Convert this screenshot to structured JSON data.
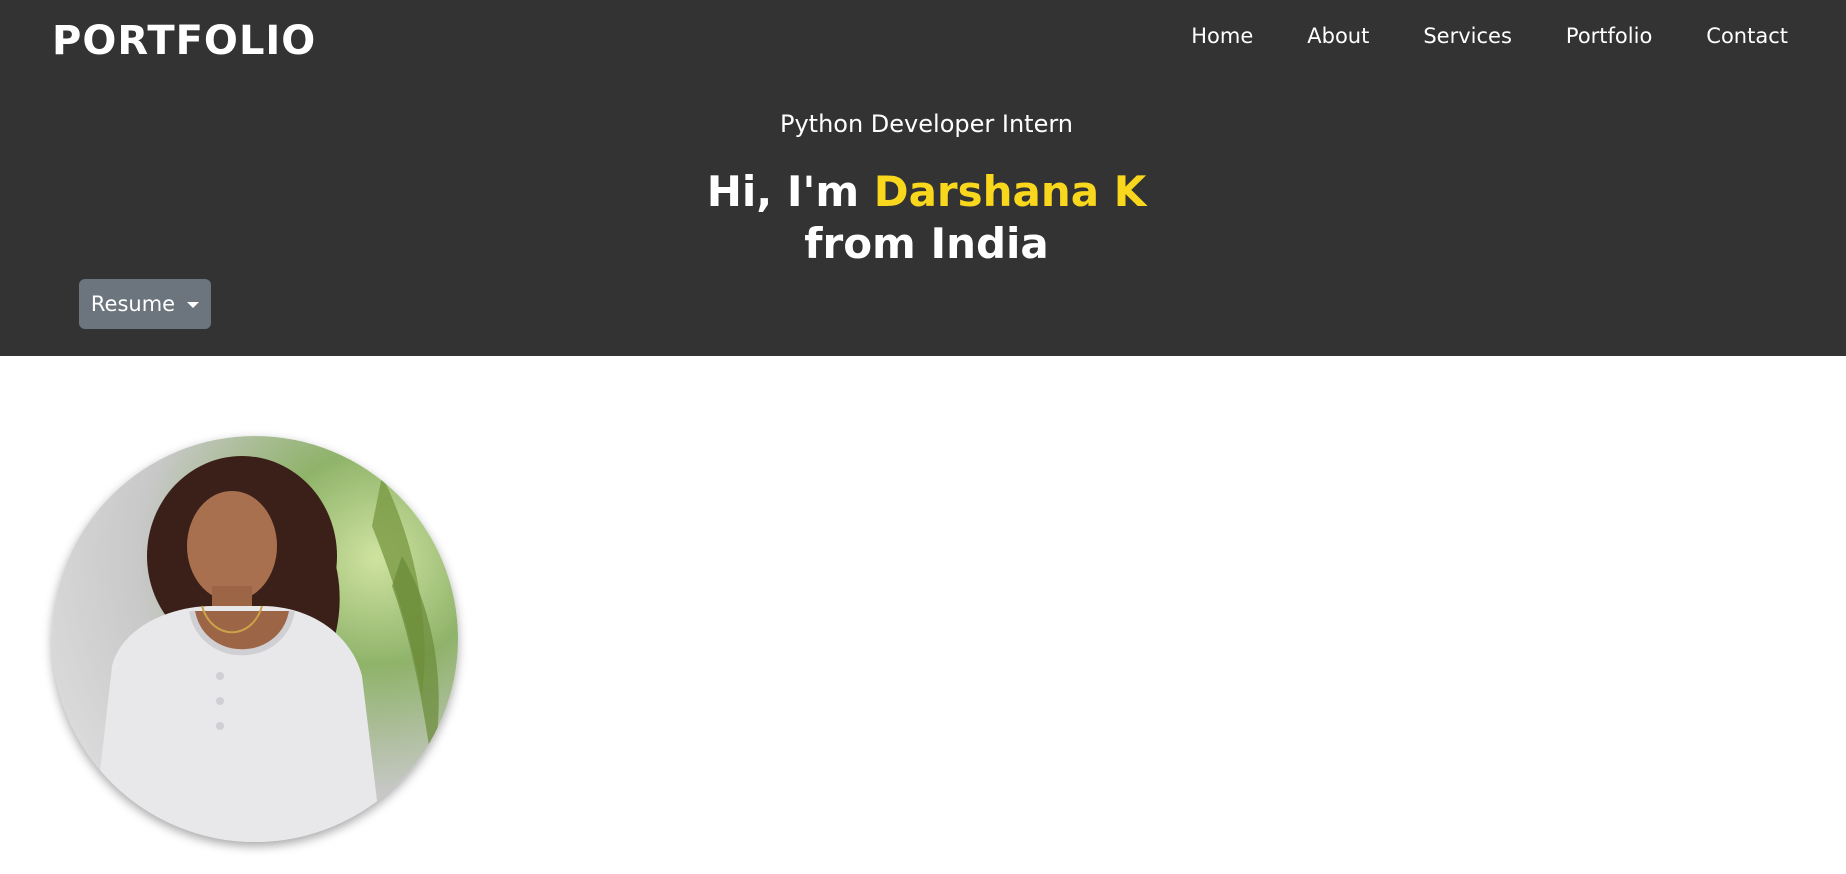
{
  "brand": "PORTFOLIO",
  "nav": [
    "Home",
    "About",
    "Services",
    "Portfolio",
    "Contact"
  ],
  "hero": {
    "subtitle": "Python Developer Intern",
    "greeting": "Hi, I'm ",
    "name": "Darshana K",
    "location_line": "from India"
  },
  "resume_button": "Resume",
  "colors": {
    "hero_bg": "#333333",
    "accent": "#f9d71c",
    "button_bg": "#6c757d"
  }
}
